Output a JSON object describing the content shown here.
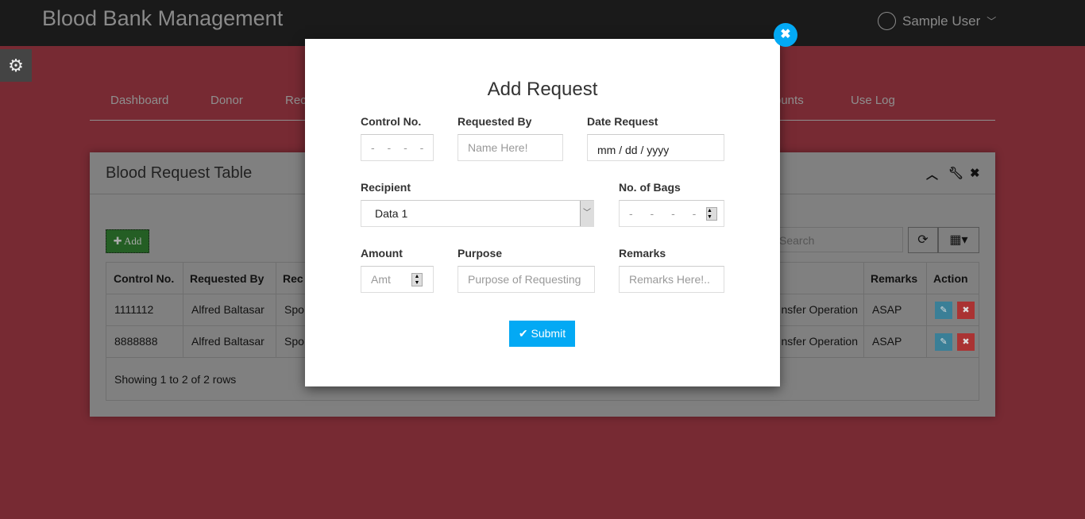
{
  "app": {
    "title": "Blood Bank Management",
    "user": "Sample User",
    "icons": {
      "user": "user-circle-icon",
      "settings": "gear-icon"
    }
  },
  "nav": {
    "items": [
      "Dashboard",
      "Donor",
      "Rec",
      "ounts",
      "Use Log"
    ]
  },
  "panel": {
    "title": "Blood Request Table",
    "add_label": "Add",
    "search_placeholder": "Search",
    "columns_visible": [
      "Control No.",
      "Requested By",
      "Rec",
      "Remarks",
      "Action"
    ],
    "rows": [
      {
        "control_no": "1111112",
        "requested_by": "Alfred Baltasar",
        "recipient": "Spo",
        "purpose": "nsfer Operation",
        "remarks": "ASAP"
      },
      {
        "control_no": "8888888",
        "requested_by": "Alfred Baltasar",
        "recipient": "Spo",
        "purpose": "nsfer Operation",
        "remarks": "ASAP"
      }
    ],
    "footer": "Showing 1 to 2 of 2 rows"
  },
  "modal": {
    "title": "Add Request",
    "control_no": {
      "label": "Control No.",
      "value": "- - - -"
    },
    "requested_by": {
      "label": "Requested By",
      "placeholder": "Name Here!"
    },
    "date_request": {
      "label": "Date Request",
      "value": "mm / dd / yyyy"
    },
    "recipient": {
      "label": "Recipient",
      "value": "Data 1"
    },
    "bags": {
      "label": "No. of Bags",
      "value": "- - - -"
    },
    "amount": {
      "label": "Amount",
      "placeholder": "Amt"
    },
    "purpose": {
      "label": "Purpose",
      "placeholder": "Purpose of Requesting"
    },
    "remarks": {
      "label": "Remarks",
      "placeholder": "Remarks Here!.."
    },
    "submit": "Submit"
  },
  "colors": {
    "accent": "#03a9f4",
    "add_button": "#245e24",
    "delete": "#a33",
    "edit": "#3a7f97"
  }
}
